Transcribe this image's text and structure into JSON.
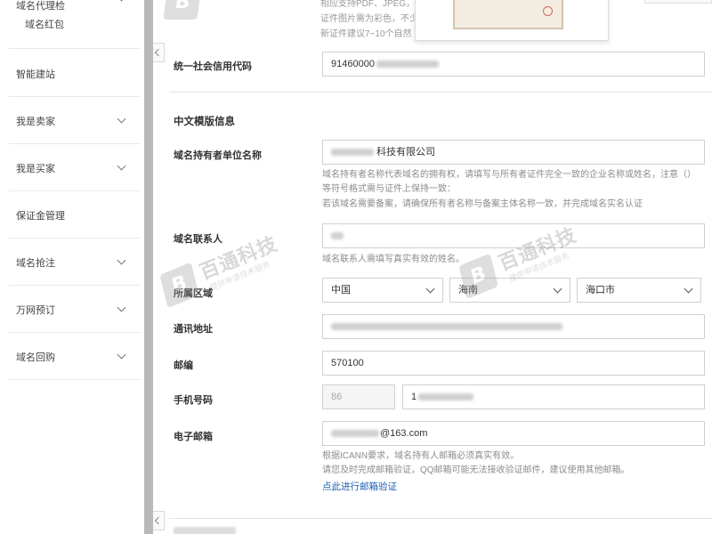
{
  "sidebar": {
    "items": [
      {
        "label": "域名代理检",
        "sub": "域名红包"
      },
      {
        "label": "智能建站"
      },
      {
        "label": "我是卖家"
      },
      {
        "label": "我是买家"
      },
      {
        "label": "保证金管理"
      },
      {
        "label": "域名抢注"
      },
      {
        "label": "万网预订"
      },
      {
        "label": "域名回购"
      }
    ]
  },
  "top_hints": [
    "相应支持PDF、JPEG，",
    "证件图片需为彩色，不少",
    "新证件建议7~10个自然"
  ],
  "form": {
    "credit_code": {
      "label": "统一社会信用代码",
      "value": "91460000"
    },
    "section_title": "中文模版信息",
    "holder": {
      "label": "域名持有者单位名称",
      "value": "科技有限公司",
      "hints": [
        "域名持有者名称代表域名的拥有权，请填写与所有者证件完全一致的企业名称或姓名，注意（）",
        "等符号格式需与证件上保持一致：",
        "若该域名需要备案，请确保所有者名称与备案主体名称一致，并完成域名实名认证"
      ]
    },
    "contact": {
      "label": "域名联系人",
      "hint": "域名联系人需填写真实有效的姓名。"
    },
    "region": {
      "label": "所属区域",
      "country": "中国",
      "province": "海南",
      "city": "海口市"
    },
    "address": {
      "label": "通讯地址"
    },
    "postcode": {
      "label": "邮编",
      "value": "570100"
    },
    "phone": {
      "label": "手机号码",
      "country_code": "86",
      "number": "1"
    },
    "email": {
      "label": "电子邮箱",
      "value": "@163.com",
      "hints": [
        "根据ICANN要求，域名持有人邮箱必须真实有效。",
        "请您及时完成邮箱验证，QQ邮箱可能无法接收验证邮件，建议使用其他邮箱。"
      ],
      "verify_link": "点此进行邮箱验证"
    }
  },
  "watermark": {
    "title": "百通科技",
    "subtitle": "提供申请技术服务",
    "logo": "B"
  },
  "colors": {
    "link": "#1a5fb4",
    "gutter": "#b9b9b9",
    "hint": "#8c8c8c"
  }
}
